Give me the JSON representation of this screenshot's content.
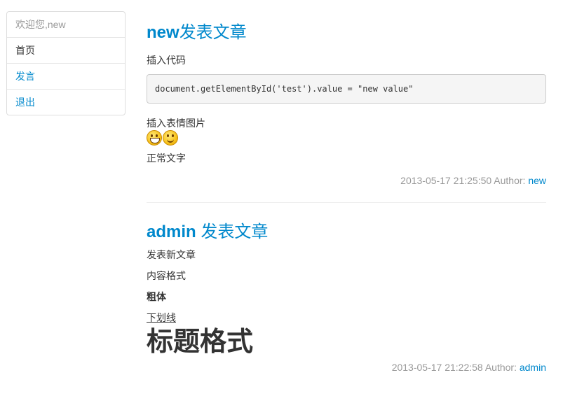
{
  "sidebar": {
    "welcome": "欢迎您,new",
    "items": [
      {
        "label": "首页"
      },
      {
        "label": "发言"
      },
      {
        "label": "退出"
      }
    ]
  },
  "posts": [
    {
      "author_prefix": "new",
      "title_suffix": "发表文章",
      "lines": [
        "插入代码",
        "插入表情图片",
        "正常文字"
      ],
      "code": "document.getElementById('test').value = \"new value\"",
      "emojis": [
        "grin-emoji",
        "smile-emoji"
      ],
      "timestamp": "2013-05-17 21:25:50 Author:",
      "author": "new"
    },
    {
      "author_prefix": "admin",
      "title_suffix": "发表文章",
      "lines": [
        "发表新文章",
        "内容格式",
        "粗体",
        "下划线"
      ],
      "heading": "标题格式",
      "timestamp": "2013-05-17 21:22:58 Author:",
      "author": "admin"
    }
  ],
  "colors": {
    "link": "#0088cc",
    "muted": "#999999",
    "text": "#333333"
  }
}
